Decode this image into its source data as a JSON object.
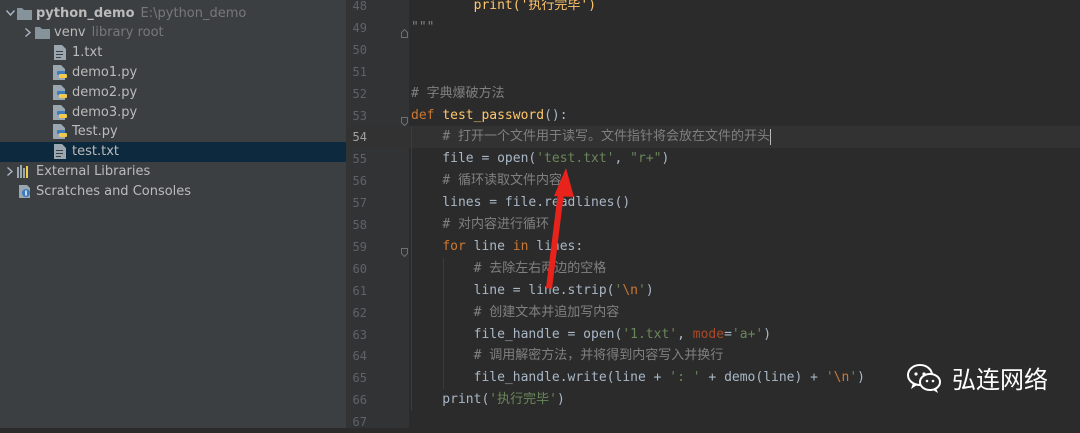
{
  "project_tree": [
    {
      "indent": 0,
      "chevron": "expanded",
      "icon": "folder-icon",
      "label": "python_demo",
      "bold": true,
      "hint": "E:\\python_demo"
    },
    {
      "indent": 1,
      "chevron": "collapsed",
      "icon": "folder-icon",
      "label": "venv",
      "hint": "library root"
    },
    {
      "indent": 2,
      "chevron": "",
      "icon": "text-file-icon",
      "label": "1.txt"
    },
    {
      "indent": 2,
      "chevron": "",
      "icon": "python-file-icon",
      "label": "demo1.py"
    },
    {
      "indent": 2,
      "chevron": "",
      "icon": "python-file-icon",
      "label": "demo2.py"
    },
    {
      "indent": 2,
      "chevron": "",
      "icon": "python-file-icon",
      "label": "demo3.py"
    },
    {
      "indent": 2,
      "chevron": "",
      "icon": "python-file-icon",
      "label": "Test.py"
    },
    {
      "indent": 2,
      "chevron": "",
      "icon": "text-file-icon",
      "label": "test.txt",
      "selected": true
    },
    {
      "indent": 0,
      "chevron": "collapsed",
      "icon": "libraries-icon",
      "label": "External Libraries"
    },
    {
      "indent": 0,
      "chevron": "",
      "icon": "scratches-icon",
      "label": "Scratches and Consoles"
    }
  ],
  "editor": {
    "current_line": 54,
    "lines": [
      {
        "n": 48,
        "tokens": [
          [
            "fn",
            "        print('执行完毕')"
          ]
        ]
      },
      {
        "n": 49,
        "fold": "end",
        "tokens": [
          [
            "cm",
            "\"\"\""
          ]
        ]
      },
      {
        "n": 50,
        "tokens": []
      },
      {
        "n": 51,
        "tokens": []
      },
      {
        "n": 52,
        "tokens": [
          [
            "cm",
            "# 字典爆破方法"
          ]
        ]
      },
      {
        "n": 53,
        "fold": "start",
        "tokens": [
          [
            "kw",
            "def "
          ],
          [
            "fn",
            "test_password"
          ],
          [
            "",
            "():"
          ]
        ]
      },
      {
        "n": 54,
        "tokens": [
          [
            "",
            "    "
          ],
          [
            "cm",
            "# 打开一个文件用于读写。文件指针将会放在文件的开头"
          ]
        ],
        "caret": true
      },
      {
        "n": 55,
        "tokens": [
          [
            "",
            "    file = open("
          ],
          [
            "str",
            "'test.txt'"
          ],
          [
            "",
            ", "
          ],
          [
            "str",
            "\"r+\""
          ],
          [
            "",
            ")"
          ]
        ]
      },
      {
        "n": 56,
        "tokens": [
          [
            "",
            "    "
          ],
          [
            "cm",
            "# 循环读取文件内容"
          ]
        ]
      },
      {
        "n": 57,
        "tokens": [
          [
            "",
            "    lines = file.readlines()"
          ]
        ]
      },
      {
        "n": 58,
        "tokens": [
          [
            "",
            "    "
          ],
          [
            "cm",
            "# 对内容进行循环"
          ]
        ]
      },
      {
        "n": 59,
        "fold": "start",
        "tokens": [
          [
            "",
            "    "
          ],
          [
            "kw",
            "for "
          ],
          [
            "",
            "line "
          ],
          [
            "kw",
            "in "
          ],
          [
            "",
            "lines:"
          ]
        ]
      },
      {
        "n": 60,
        "tokens": [
          [
            "",
            "        "
          ],
          [
            "cm",
            "# 去除左右两边的空格"
          ]
        ]
      },
      {
        "n": 61,
        "tokens": [
          [
            "",
            "        line = line.strip("
          ],
          [
            "str",
            "'"
          ],
          [
            "esc",
            "\\n"
          ],
          [
            "str",
            "'"
          ],
          [
            "",
            ")"
          ]
        ]
      },
      {
        "n": 62,
        "tokens": [
          [
            "",
            "        "
          ],
          [
            "cm",
            "# 创建文本并追加写内容"
          ]
        ]
      },
      {
        "n": 63,
        "tokens": [
          [
            "",
            "        file_handle = open("
          ],
          [
            "str",
            "'1.txt'"
          ],
          [
            "",
            ", "
          ],
          [
            "param",
            "mode"
          ],
          [
            "",
            "="
          ],
          [
            "str",
            "'a+'"
          ],
          [
            "",
            ")"
          ]
        ]
      },
      {
        "n": 64,
        "tokens": [
          [
            "",
            "        "
          ],
          [
            "cm",
            "# 调用解密方法，并将得到内容写入并换行"
          ]
        ]
      },
      {
        "n": 65,
        "tokens": [
          [
            "",
            "        file_handle.write(line + "
          ],
          [
            "str",
            "': '"
          ],
          [
            "",
            " + demo(line) + "
          ],
          [
            "str",
            "'"
          ],
          [
            "esc",
            "\\n"
          ],
          [
            "str",
            "'"
          ],
          [
            "",
            ")"
          ]
        ]
      },
      {
        "n": 66,
        "tokens": [
          [
            "",
            "    print("
          ],
          [
            "str",
            "'执行完毕'"
          ],
          [
            "",
            ")"
          ]
        ]
      },
      {
        "n": 67,
        "tokens": []
      }
    ]
  },
  "colors": {
    "sidebar_bg": "#3c3f41",
    "editor_bg": "#2b2b2b",
    "keyword": "#cc7832",
    "function": "#ffc66d",
    "string": "#6a8759",
    "comment": "#808080",
    "annotation_arrow": "#e8231c"
  },
  "annotation": {
    "shape": "red-arrow",
    "points_to": "test.txt"
  },
  "watermark": {
    "icon": "wechat-icon",
    "text": "弘连网络"
  }
}
